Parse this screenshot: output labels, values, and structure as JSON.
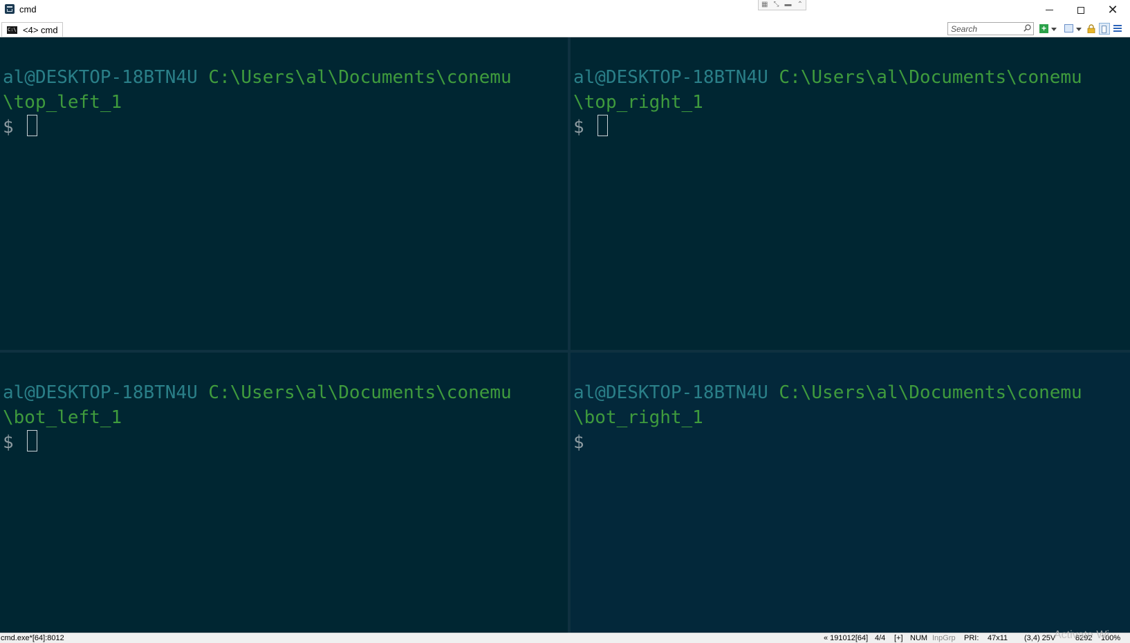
{
  "window": {
    "title": "cmd",
    "mini_tools": [
      "▦",
      "⤡",
      "▬",
      "⌃"
    ]
  },
  "tabbar": {
    "tab_icon_text": "C:\\",
    "tab_label": "<4> cmd",
    "search_placeholder": "Search"
  },
  "panes": {
    "top_left": {
      "user_host": "al@DESKTOP-18BTN4U",
      "path_line1": "C:\\Users\\al\\Documents\\conemu",
      "path_line2": "\\top_left_1",
      "prompt": "$"
    },
    "top_right": {
      "user_host": "al@DESKTOP-18BTN4U",
      "path_line1": "C:\\Users\\al\\Documents\\conemu",
      "path_line2": "\\top_right_1",
      "prompt": "$"
    },
    "bot_left": {
      "user_host": "al@DESKTOP-18BTN4U",
      "path_line1": "C:\\Users\\al\\Documents\\conemu",
      "path_line2": "\\bot_left_1",
      "prompt": "$"
    },
    "bot_right": {
      "user_host": "al@DESKTOP-18BTN4U",
      "path_line1": "C:\\Users\\al\\Documents\\conemu",
      "path_line2": "\\bot_right_1",
      "prompt": "$"
    }
  },
  "statusbar": {
    "process": "cmd.exe*[64]:8012",
    "build": "« 191012[64]",
    "console_index": "4/4",
    "plus": "[+]",
    "num": "NUM",
    "inpgrp": "InpGrp",
    "priority": "PRI:",
    "size": "47x11",
    "cursor_pos": "(3,4) 25V",
    "pid": "8292",
    "zoom": "100%",
    "watermark": "Activate Wi"
  },
  "colors": {
    "user_host": "#2a7f88",
    "path": "#3f9b3d",
    "pane_bg": "#002632",
    "active_pane_bg": "#03283a"
  }
}
